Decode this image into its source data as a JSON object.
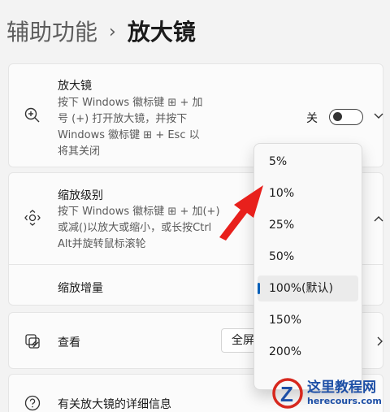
{
  "breadcrumb": {
    "parent": "辅助功能",
    "separator": "›",
    "current": "放大镜"
  },
  "magnifier": {
    "title": "放大镜",
    "desc_lines": [
      "按下 Windows 徽标键 ⊞ + 加",
      "号 (+) 打开放大镜，并按下",
      "Windows 徽标键 ⊞ + Esc 以",
      "将其关闭"
    ],
    "toggle_label": "关",
    "toggle_state": "off"
  },
  "zoom_level": {
    "title": "缩放级别",
    "desc_lines": [
      "按下 Windows 徽标键 ⊞ + 加(+)",
      "或减()以放大或缩小，或长按Ctrl",
      "Alt并旋转鼠标滚轮"
    ]
  },
  "zoom_increment": {
    "title": "缩放增量"
  },
  "zoom_options": [
    "5%",
    "10%",
    "25%",
    "50%",
    "100%(默认)",
    "150%",
    "200%"
  ],
  "zoom_selected": "100%(默认)",
  "view": {
    "title": "查看",
    "value": "全屏"
  },
  "details": {
    "title": "有关放大镜的详细信息"
  },
  "watermark": {
    "logo_letter": "Z",
    "title": "这里教程网",
    "subtitle": "herecours.com"
  },
  "colors": {
    "accent": "#005fb8",
    "arrow": "#e8201c",
    "watermark": "#1d4fa6"
  }
}
